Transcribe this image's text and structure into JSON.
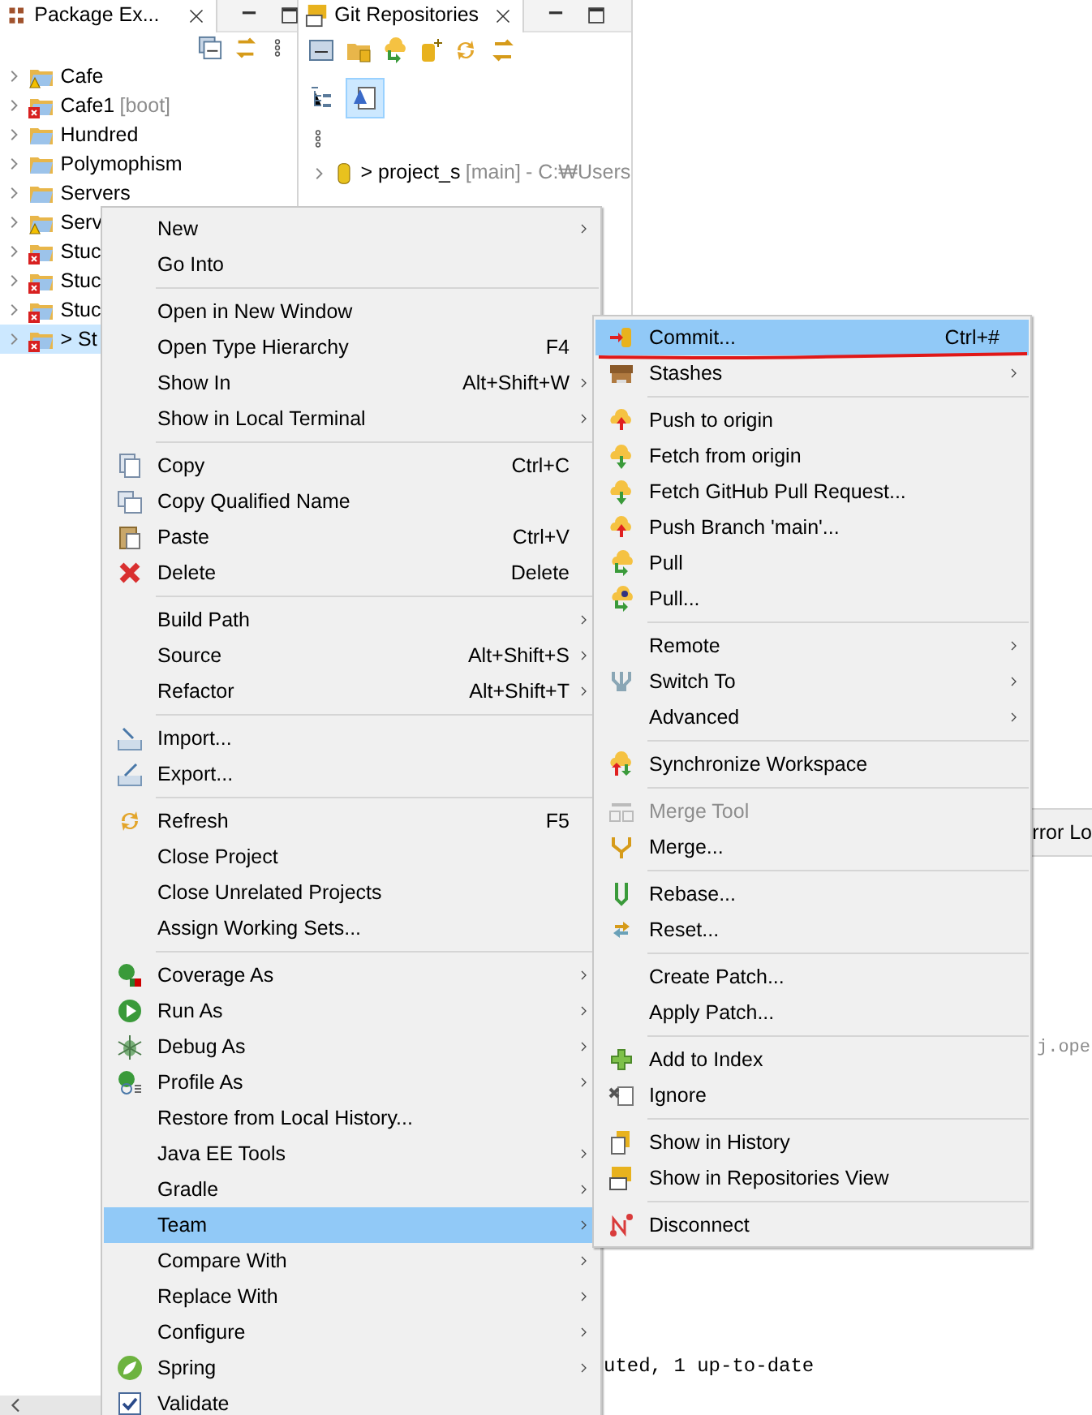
{
  "package_explorer": {
    "tab_title": "Package Ex...",
    "items": [
      {
        "label": "Cafe",
        "kind": "warning",
        "selected": false
      },
      {
        "label": "Cafe1",
        "suffix": "[boot]",
        "kind": "error",
        "selected": false
      },
      {
        "label": "Hundred",
        "kind": "plain",
        "selected": false
      },
      {
        "label": "Polymophism",
        "kind": "plain",
        "selected": false
      },
      {
        "label": "Servers",
        "kind": "plain",
        "selected": false
      },
      {
        "label": "Serv",
        "kind": "warning",
        "selected": false
      },
      {
        "label": "Stuc",
        "kind": "error",
        "selected": false
      },
      {
        "label": "Stuc",
        "kind": "error",
        "selected": false
      },
      {
        "label": "Stuc",
        "kind": "error",
        "selected": false
      },
      {
        "label": "> St",
        "kind": "error",
        "selected": true
      }
    ]
  },
  "git_repositories": {
    "tab_title": "Git Repositories",
    "repository": {
      "label": "> project_s",
      "branch": "[main]",
      "path": "- C:₩Users"
    }
  },
  "console": {
    "tab_title": "rror Lo",
    "lines": [
      {
        "text": "j.ope",
        "kind": "muted"
      },
      {
        "text": "uted, 1 up-to-date",
        "kind": "plain"
      }
    ]
  },
  "context_menu": {
    "items": [
      {
        "kind": "item",
        "label": "New",
        "submenu": true,
        "selected": false
      },
      {
        "kind": "item",
        "label": "Go Into",
        "selected": false
      },
      {
        "kind": "separator"
      },
      {
        "kind": "item",
        "label": "Open in New Window",
        "selected": false
      },
      {
        "kind": "item",
        "label": "Open Type Hierarchy",
        "shortcut": "F4",
        "selected": false
      },
      {
        "kind": "item",
        "label": "Show In",
        "shortcut": "Alt+Shift+W",
        "submenu": true,
        "selected": false
      },
      {
        "kind": "item",
        "label": "Show in Local Terminal",
        "submenu": true,
        "selected": false
      },
      {
        "kind": "separator"
      },
      {
        "kind": "item",
        "label": "Copy",
        "shortcut": "Ctrl+C",
        "selected": false
      },
      {
        "kind": "item",
        "label": "Copy Qualified Name",
        "selected": false
      },
      {
        "kind": "item",
        "label": "Paste",
        "shortcut": "Ctrl+V",
        "selected": false
      },
      {
        "kind": "item",
        "label": "Delete",
        "shortcut": "Delete",
        "selected": false
      },
      {
        "kind": "separator"
      },
      {
        "kind": "item",
        "label": "Build Path",
        "submenu": true,
        "selected": false
      },
      {
        "kind": "item",
        "label": "Source",
        "shortcut": "Alt+Shift+S",
        "submenu": true,
        "selected": false
      },
      {
        "kind": "item",
        "label": "Refactor",
        "shortcut": "Alt+Shift+T",
        "submenu": true,
        "selected": false
      },
      {
        "kind": "separator"
      },
      {
        "kind": "item",
        "label": "Import...",
        "selected": false
      },
      {
        "kind": "item",
        "label": "Export...",
        "selected": false
      },
      {
        "kind": "separator"
      },
      {
        "kind": "item",
        "label": "Refresh",
        "shortcut": "F5",
        "selected": false
      },
      {
        "kind": "item",
        "label": "Close Project",
        "selected": false
      },
      {
        "kind": "item",
        "label": "Close Unrelated Projects",
        "selected": false
      },
      {
        "kind": "item",
        "label": "Assign Working Sets...",
        "selected": false
      },
      {
        "kind": "separator"
      },
      {
        "kind": "item",
        "label": "Coverage As",
        "submenu": true,
        "selected": false
      },
      {
        "kind": "item",
        "label": "Run As",
        "submenu": true,
        "selected": false
      },
      {
        "kind": "item",
        "label": "Debug As",
        "submenu": true,
        "selected": false
      },
      {
        "kind": "item",
        "label": "Profile As",
        "submenu": true,
        "selected": false
      },
      {
        "kind": "item",
        "label": "Restore from Local History...",
        "selected": false
      },
      {
        "kind": "item",
        "label": "Java EE Tools",
        "submenu": true,
        "selected": false
      },
      {
        "kind": "item",
        "label": "Gradle",
        "submenu": true,
        "selected": false
      },
      {
        "kind": "item",
        "label": "Team",
        "submenu": true,
        "selected": true
      },
      {
        "kind": "item",
        "label": "Compare With",
        "submenu": true,
        "selected": false
      },
      {
        "kind": "item",
        "label": "Replace With",
        "submenu": true,
        "selected": false
      },
      {
        "kind": "item",
        "label": "Configure",
        "submenu": true,
        "selected": false
      },
      {
        "kind": "item",
        "label": "Spring",
        "submenu": true,
        "selected": false
      },
      {
        "kind": "item",
        "label": "Validate",
        "selected": false
      }
    ]
  },
  "team_menu": {
    "items": [
      {
        "kind": "item",
        "label": "Commit...",
        "shortcut": "Ctrl+#",
        "selected": true,
        "underlined": true
      },
      {
        "kind": "item",
        "label": "Stashes",
        "submenu": true,
        "selected": false
      },
      {
        "kind": "separator"
      },
      {
        "kind": "item",
        "label": "Push to origin",
        "selected": false
      },
      {
        "kind": "item",
        "label": "Fetch from origin",
        "selected": false
      },
      {
        "kind": "item",
        "label": "Fetch GitHub Pull Request...",
        "selected": false
      },
      {
        "kind": "item",
        "label": "Push Branch 'main'...",
        "selected": false
      },
      {
        "kind": "item",
        "label": "Pull",
        "selected": false
      },
      {
        "kind": "item",
        "label": "Pull...",
        "selected": false
      },
      {
        "kind": "separator"
      },
      {
        "kind": "item",
        "label": "Remote",
        "submenu": true,
        "selected": false
      },
      {
        "kind": "item",
        "label": "Switch To",
        "submenu": true,
        "selected": false
      },
      {
        "kind": "item",
        "label": "Advanced",
        "submenu": true,
        "selected": false
      },
      {
        "kind": "separator"
      },
      {
        "kind": "item",
        "label": "Synchronize Workspace",
        "selected": false
      },
      {
        "kind": "separator"
      },
      {
        "kind": "item",
        "label": "Merge Tool",
        "disabled": true,
        "selected": false
      },
      {
        "kind": "item",
        "label": "Merge...",
        "selected": false
      },
      {
        "kind": "separator"
      },
      {
        "kind": "item",
        "label": "Rebase...",
        "selected": false
      },
      {
        "kind": "item",
        "label": "Reset...",
        "selected": false
      },
      {
        "kind": "separator"
      },
      {
        "kind": "item",
        "label": "Create Patch...",
        "selected": false
      },
      {
        "kind": "item",
        "label": "Apply Patch...",
        "selected": false
      },
      {
        "kind": "separator"
      },
      {
        "kind": "item",
        "label": "Add to Index",
        "selected": false
      },
      {
        "kind": "item",
        "label": "Ignore",
        "selected": false
      },
      {
        "kind": "separator"
      },
      {
        "kind": "item",
        "label": "Show in History",
        "selected": false
      },
      {
        "kind": "item",
        "label": "Show in Repositories View",
        "selected": false
      },
      {
        "kind": "separator"
      },
      {
        "kind": "item",
        "label": "Disconnect",
        "selected": false
      }
    ]
  }
}
